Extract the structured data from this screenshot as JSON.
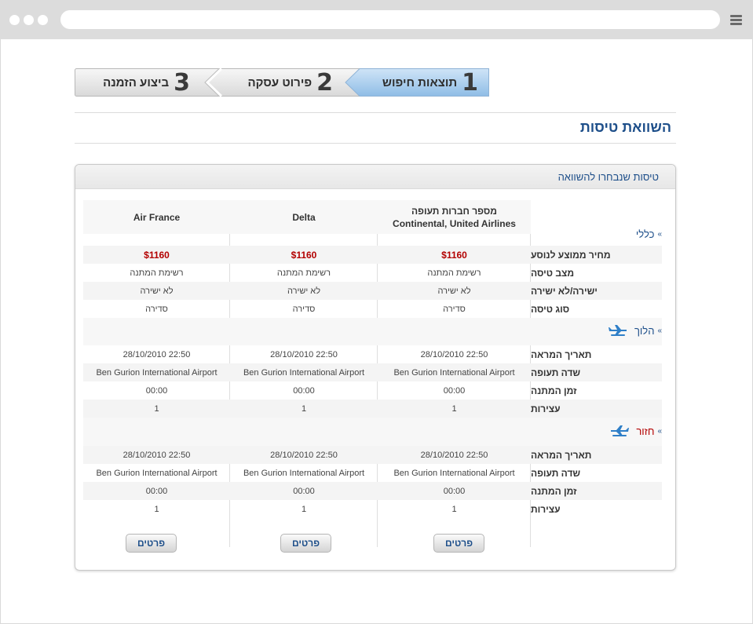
{
  "stepper": {
    "steps": [
      {
        "num": "1",
        "label": "תוצאות חיפוש",
        "active": true
      },
      {
        "num": "2",
        "label": "פירוט עסקה",
        "active": false
      },
      {
        "num": "3",
        "label": "ביצוע הזמנה",
        "active": false
      }
    ]
  },
  "page": {
    "title": "השוואת טיסות"
  },
  "panel": {
    "title": "טיסות שנבחרו להשוואה"
  },
  "columns": {
    "col3": {
      "line1": "מספר חברות תעופה",
      "line2": "Continental, United Airlines"
    },
    "col2": "Delta",
    "col1": "Air France"
  },
  "sections": {
    "general": {
      "label": "כללי"
    },
    "outbound": {
      "label": "הלוך"
    },
    "return": {
      "label": "חזור"
    }
  },
  "general_rows": [
    {
      "label": "מחיר ממוצע לנוסע",
      "values": [
        "$1160",
        "$1160",
        "$1160"
      ],
      "price": true
    },
    {
      "label": "מצב טיסה",
      "values": [
        "רשימת המתנה",
        "רשימת המתנה",
        "רשימת המתנה"
      ]
    },
    {
      "label": "ישירה/לא ישירה",
      "values": [
        "לא ישירה",
        "לא ישירה",
        "לא ישירה"
      ]
    },
    {
      "label": "סוג טיסה",
      "values": [
        "סדירה",
        "סדירה",
        "סדירה"
      ]
    }
  ],
  "outbound_rows": [
    {
      "label": "תאריך המראה",
      "values": [
        "28/10/2010 22:50",
        "28/10/2010 22:50",
        "28/10/2010 22:50"
      ]
    },
    {
      "label": "שדה תעופה",
      "values": [
        "Ben Gurion International Airport",
        "Ben Gurion International Airport",
        "Ben Gurion International Airport"
      ]
    },
    {
      "label": "זמן המתנה",
      "values": [
        "00:00",
        "00:00",
        "00:00"
      ]
    },
    {
      "label": "עצירות",
      "values": [
        "1",
        "1",
        "1"
      ]
    }
  ],
  "return_rows": [
    {
      "label": "תאריך המראה",
      "values": [
        "28/10/2010 22:50",
        "28/10/2010 22:50",
        "28/10/2010 22:50"
      ]
    },
    {
      "label": "שדה תעופה",
      "values": [
        "Ben Gurion International Airport",
        "Ben Gurion International Airport",
        "Ben Gurion International Airport"
      ]
    },
    {
      "label": "זמן המתנה",
      "values": [
        "00:00",
        "00:00",
        "00:00"
      ]
    },
    {
      "label": "עצירות",
      "values": [
        "1",
        "1",
        "1"
      ]
    }
  ],
  "buttons": {
    "details": "פרטים"
  },
  "colors": {
    "accent": "#1e4f8a",
    "price": "#b30000",
    "active_step": "#a9cdee",
    "inactive_step": "#ececec"
  },
  "icons": {
    "plane": "airplane-icon",
    "chevron": "double-chevron-icon",
    "menu": "hamburger-icon"
  }
}
